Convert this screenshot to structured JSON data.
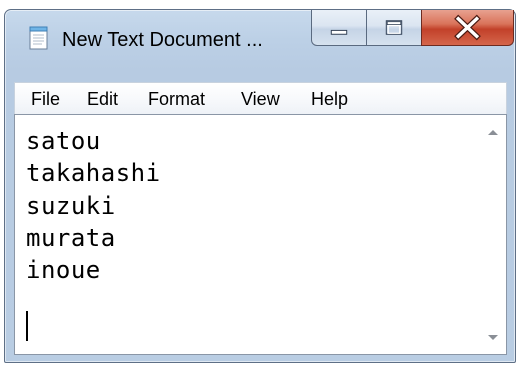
{
  "window": {
    "title": "New Text Document ...",
    "icon": "notepad-icon",
    "caption_buttons": [
      "minimize-icon",
      "maximize-icon",
      "close-icon"
    ]
  },
  "menu": {
    "items": [
      "File",
      "Edit",
      "Format",
      "View",
      "Help"
    ]
  },
  "editor": {
    "lines": [
      "satou",
      "takahashi",
      "suzuki",
      "murata",
      "inoue",
      ""
    ]
  },
  "scrollbar": {
    "up_icon": "scroll-up-arrow-icon",
    "down_icon": "scroll-down-arrow-icon"
  },
  "colors": {
    "window_frame": "#b9cde3",
    "close_button": "#c2412a",
    "editor_background": "#ffffff"
  }
}
